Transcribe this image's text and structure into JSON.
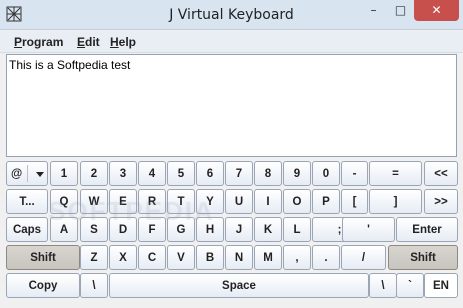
{
  "window": {
    "title": "J Virtual Keyboard",
    "minimize_glyph": "–",
    "maximize_glyph": "□",
    "close_glyph": "✕"
  },
  "menu": {
    "program": {
      "accel": "P",
      "rest": "rogram"
    },
    "edit": {
      "accel": "E",
      "rest": "dit"
    },
    "help": {
      "accel": "H",
      "rest": "elp"
    }
  },
  "editor": {
    "text": "This is a Softpedia test"
  },
  "keyboard": {
    "combo_value": "@",
    "row1": [
      "1",
      "2",
      "3",
      "4",
      "5",
      "6",
      "7",
      "8",
      "9",
      "0",
      "-",
      "=",
      "<<"
    ],
    "row2": [
      "T...",
      "Q",
      "W",
      "E",
      "R",
      "T",
      "Y",
      "U",
      "I",
      "O",
      "P",
      "[",
      "]",
      ">>"
    ],
    "row3": [
      "Caps",
      "A",
      "S",
      "D",
      "F",
      "G",
      "H",
      "J",
      "K",
      "L",
      ";",
      "'",
      "Enter"
    ],
    "row4": [
      "Shift",
      "Z",
      "X",
      "C",
      "V",
      "B",
      "N",
      "M",
      ",",
      ".",
      "/",
      "Shift"
    ],
    "row5": [
      "Copy",
      "\\",
      "Space",
      "\\",
      "`",
      "EN"
    ]
  },
  "watermark": "SOFTPEDIA"
}
